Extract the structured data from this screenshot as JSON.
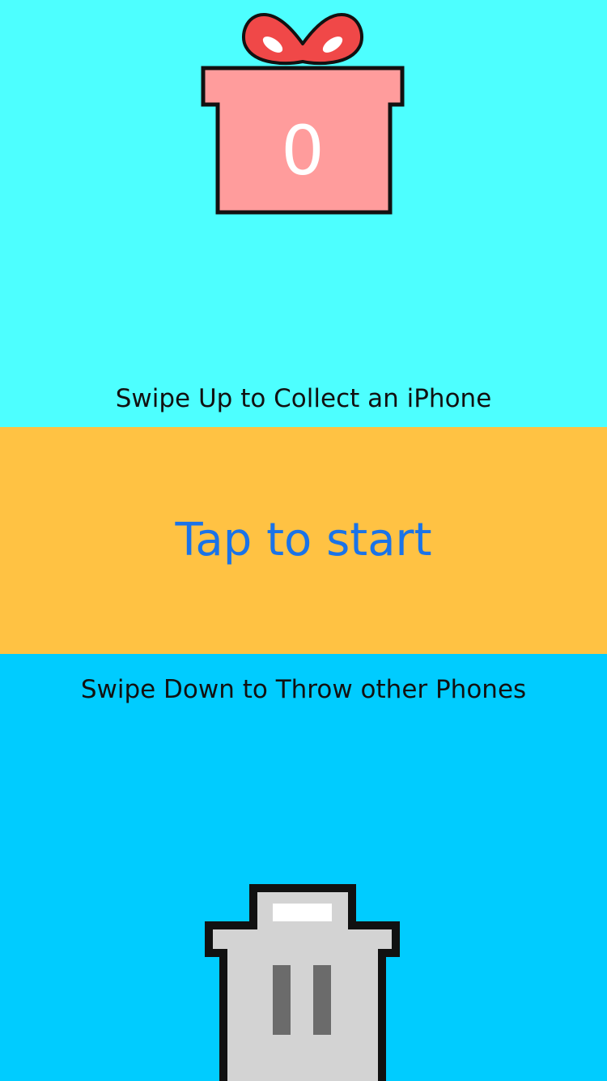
{
  "score": "0",
  "hints": {
    "swipe_up": "Swipe Up to Collect an iPhone",
    "swipe_down": "Swipe Down to Throw other Phones"
  },
  "start": {
    "label": "Tap to start"
  },
  "icons": {
    "gift": "gift-box-icon",
    "trash": "trash-can-icon"
  },
  "colors": {
    "top_background": "#4dffff",
    "middle_background": "#ffc243",
    "bottom_background": "#00ccff",
    "start_text": "#1a73e8",
    "gift_box": "#ff9c9c",
    "gift_bow": "#f04848",
    "trash_can": "#d3d3d3"
  }
}
